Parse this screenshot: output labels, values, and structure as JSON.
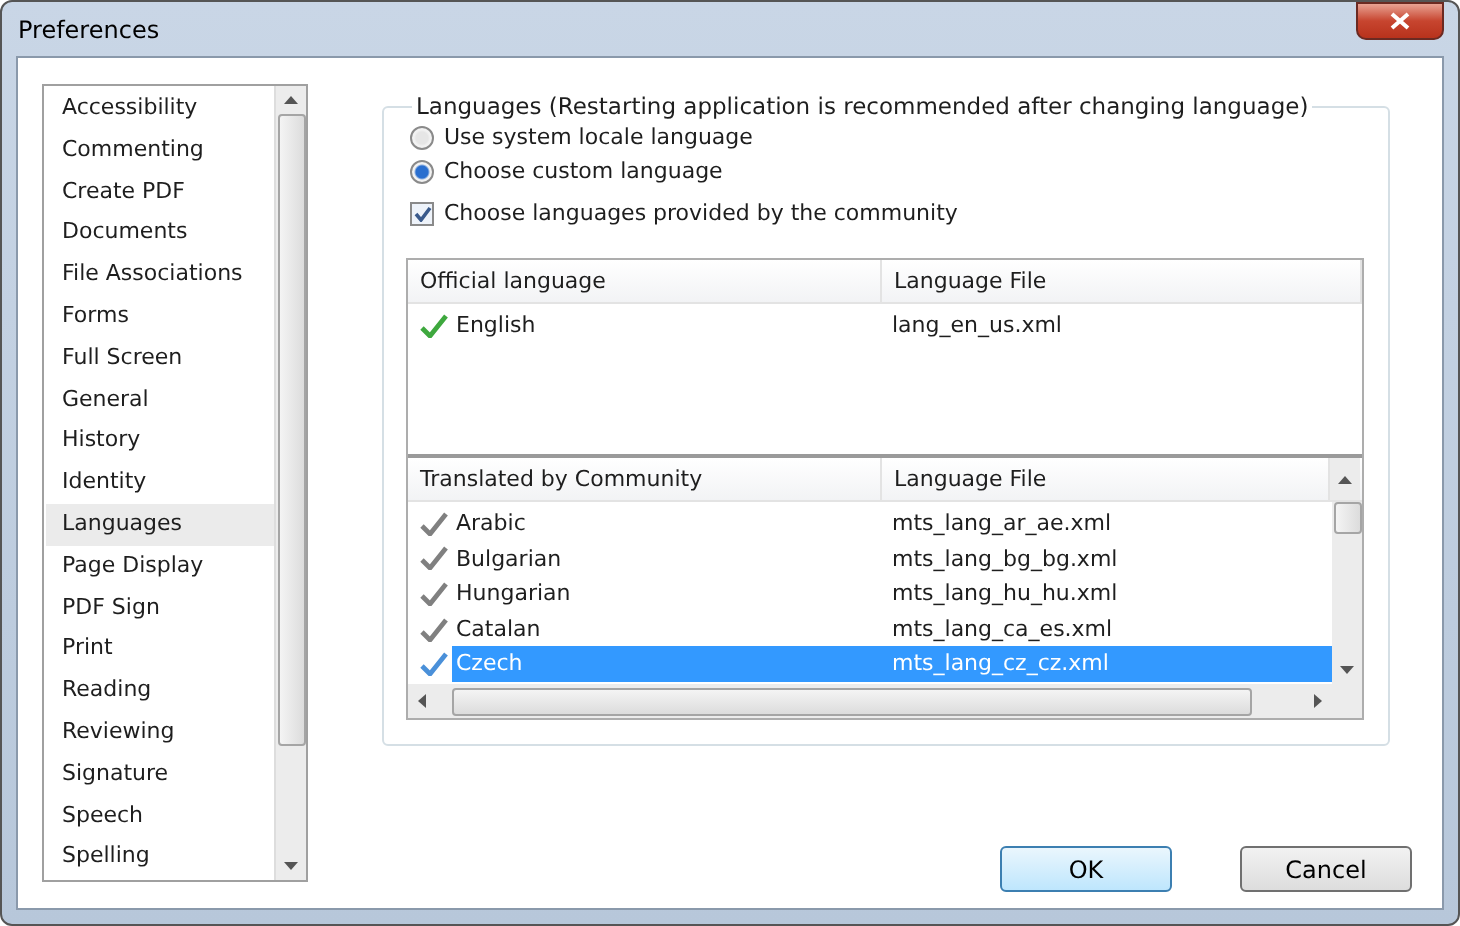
{
  "window": {
    "title": "Preferences"
  },
  "sidebar": {
    "items": [
      {
        "label": "Accessibility",
        "selected": false
      },
      {
        "label": "Commenting",
        "selected": false
      },
      {
        "label": "Create PDF",
        "selected": false
      },
      {
        "label": "Documents",
        "selected": false
      },
      {
        "label": "File Associations",
        "selected": false
      },
      {
        "label": "Forms",
        "selected": false
      },
      {
        "label": "Full Screen",
        "selected": false
      },
      {
        "label": "General",
        "selected": false
      },
      {
        "label": "History",
        "selected": false
      },
      {
        "label": "Identity",
        "selected": false
      },
      {
        "label": "Languages",
        "selected": true
      },
      {
        "label": "Page Display",
        "selected": false
      },
      {
        "label": "PDF Sign",
        "selected": false
      },
      {
        "label": "Print",
        "selected": false
      },
      {
        "label": "Reading",
        "selected": false
      },
      {
        "label": "Reviewing",
        "selected": false
      },
      {
        "label": "Signature",
        "selected": false
      },
      {
        "label": "Speech",
        "selected": false
      },
      {
        "label": "Spelling",
        "selected": false
      }
    ]
  },
  "group": {
    "title": "Languages (Restarting application is recommended after changing language)",
    "options": [
      {
        "kind": "radio",
        "label": "Use system locale language",
        "selected": false
      },
      {
        "kind": "radio",
        "label": "Choose custom language",
        "selected": true
      },
      {
        "kind": "checkbox",
        "label": "Choose languages provided by the community",
        "checked": true
      }
    ],
    "tables": [
      {
        "kind": "official",
        "columns": [
          "Official language",
          "Language File"
        ],
        "rows": [
          {
            "name": "English",
            "file": "lang_en_us.xml",
            "selected": false
          }
        ]
      },
      {
        "kind": "community",
        "columns": [
          "Translated by Community",
          "Language File"
        ],
        "rows": [
          {
            "name": "Arabic",
            "file": "mts_lang_ar_ae.xml",
            "selected": false
          },
          {
            "name": "Bulgarian",
            "file": "mts_lang_bg_bg.xml",
            "selected": false
          },
          {
            "name": "Hungarian",
            "file": "mts_lang_hu_hu.xml",
            "selected": false
          },
          {
            "name": "Catalan",
            "file": "mts_lang_ca_es.xml",
            "selected": false
          },
          {
            "name": "Czech",
            "file": "mts_lang_cz_cz.xml",
            "selected": true
          }
        ]
      }
    ]
  },
  "buttons": [
    {
      "label": "OK",
      "default": true
    },
    {
      "label": "Cancel",
      "default": false
    }
  ]
}
